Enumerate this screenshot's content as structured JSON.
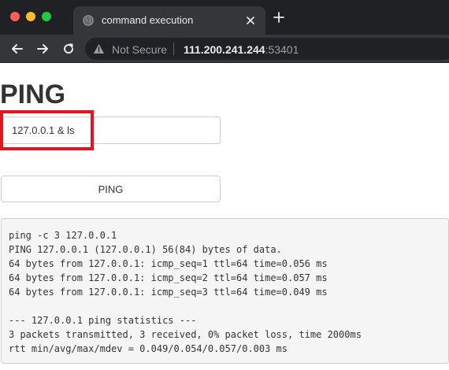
{
  "browser": {
    "tab_title": "command execution",
    "security_label": "Not Secure",
    "url_host": "111.200.241.244",
    "url_port": ":53401",
    "icons": {
      "close": "close-icon",
      "new_tab": "plus-icon",
      "back": "arrow-left-icon",
      "forward": "arrow-right-icon",
      "reload": "reload-icon",
      "warning": "warning-triangle-icon",
      "favicon": "globe-icon"
    }
  },
  "page": {
    "title": "PING",
    "input_value": "127.0.0.1 & ls",
    "button_label": "PING",
    "highlight_color": "#e8141d",
    "output_lines": [
      "ping -c 3 127.0.0.1",
      "PING 127.0.0.1 (127.0.0.1) 56(84) bytes of data.",
      "64 bytes from 127.0.0.1: icmp_seq=1 ttl=64 time=0.056 ms",
      "64 bytes from 127.0.0.1: icmp_seq=2 ttl=64 time=0.057 ms",
      "64 bytes from 127.0.0.1: icmp_seq=3 ttl=64 time=0.049 ms",
      "",
      "--- 127.0.0.1 ping statistics ---",
      "3 packets transmitted, 3 received, 0% packet loss, time 2000ms",
      "rtt min/avg/max/mdev = 0.049/0.054/0.057/0.003 ms"
    ]
  }
}
